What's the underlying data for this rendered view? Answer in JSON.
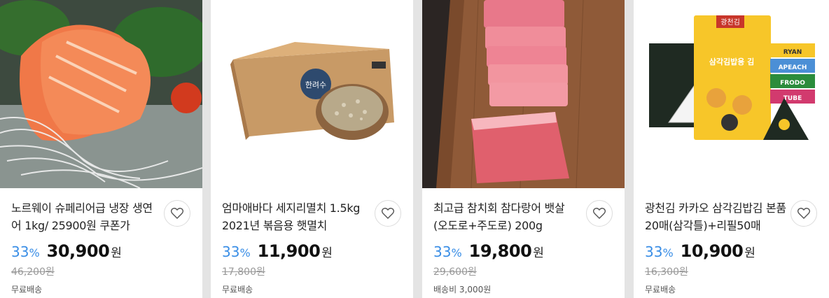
{
  "products": [
    {
      "title": "노르웨이 슈페리어급 냉장 생연어 1kg/ 25900원 쿠폰가",
      "discount": "33",
      "discount_unit": "%",
      "price": "30,900",
      "currency": "원",
      "original_price": "46,200원",
      "shipping": "무료배송",
      "image": "salmon-sashimi"
    },
    {
      "title": "엄마애바다 세지리멸치 1.5kg 2021년 볶음용 햇멸치",
      "discount": "33",
      "discount_unit": "%",
      "price": "11,900",
      "currency": "원",
      "original_price": "17,800원",
      "shipping": "무료배송",
      "image": "anchovy-box"
    },
    {
      "title": "최고급 참치회 참다랑어 뱃살(오도로+주도로) 200g",
      "discount": "33",
      "discount_unit": "%",
      "price": "19,800",
      "currency": "원",
      "original_price": "29,600원",
      "shipping": "배송비 3,000원",
      "image": "tuna-belly"
    },
    {
      "title": "광천김 카카오 삼각김밥김 본품20매(삼각틀)+리필50매",
      "discount": "33",
      "discount_unit": "%",
      "price": "10,900",
      "currency": "원",
      "original_price": "16,300원",
      "shipping": "무료배송",
      "image": "kakao-seaweed",
      "image_texts": {
        "brand": "광천김",
        "labels": [
          "RYAN",
          "APEACH",
          "FRODO",
          "TUBE"
        ],
        "headline": "삼각김밥용 김"
      }
    }
  ],
  "colors": {
    "discount": "#3a8ee6",
    "price": "#111111",
    "original": "#999999"
  },
  "wishlist_icon": "heart-outline-icon"
}
